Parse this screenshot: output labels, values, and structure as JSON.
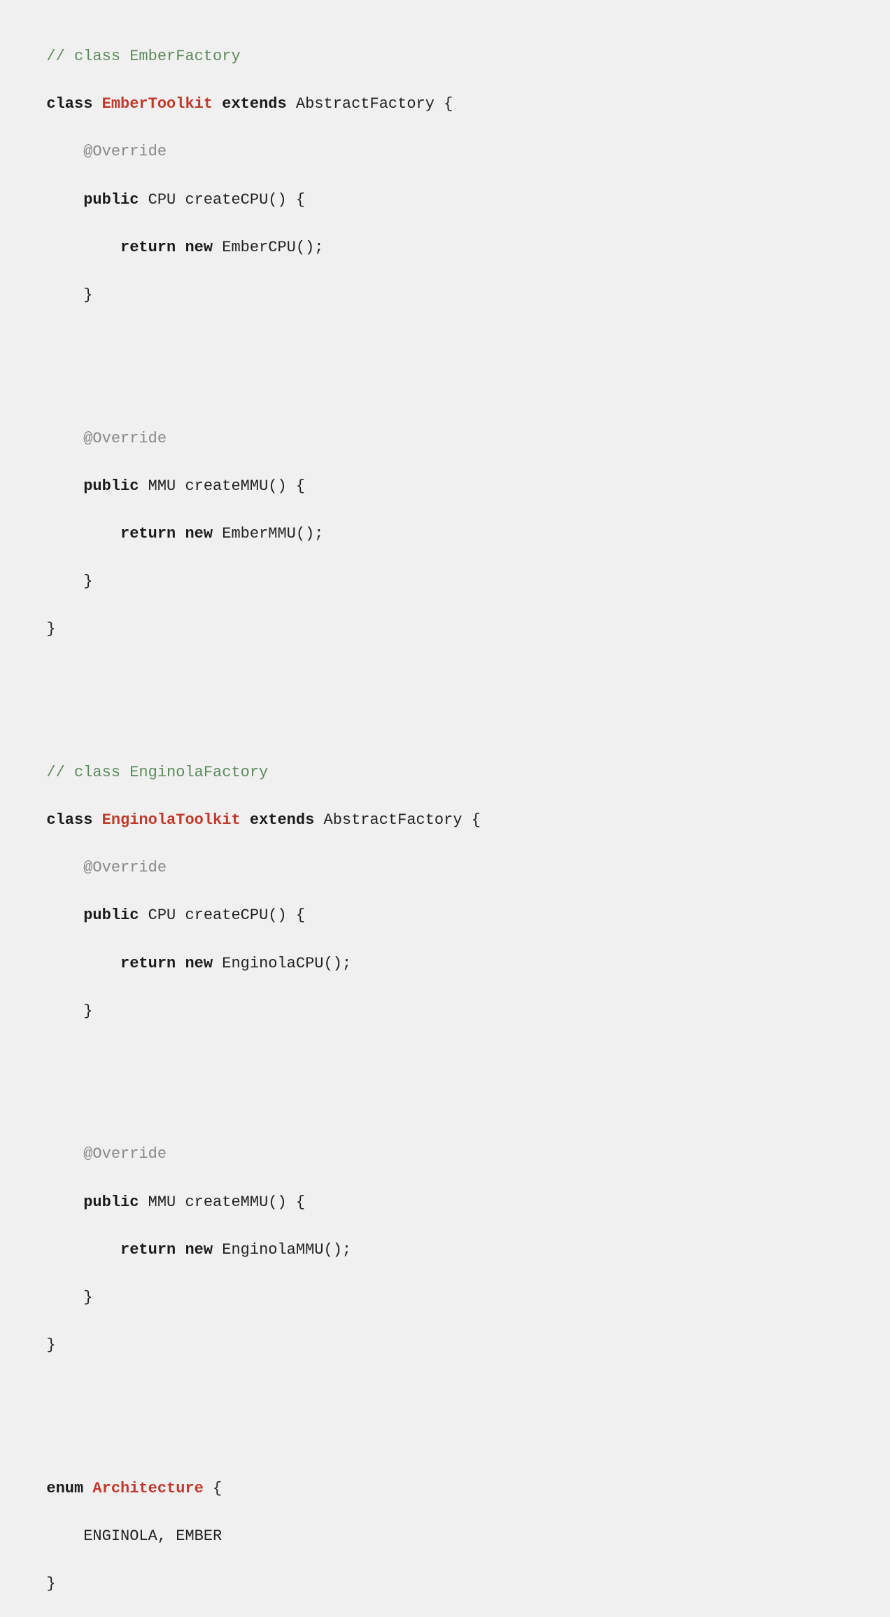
{
  "code": {
    "lines": [
      {
        "type": "comment",
        "text": "// class EmberFactory"
      },
      {
        "type": "mixed",
        "parts": [
          {
            "style": "keyword",
            "text": "class "
          },
          {
            "style": "class-name",
            "text": "EmberToolkit"
          },
          {
            "style": "keyword",
            "text": " extends"
          },
          {
            "style": "normal",
            "text": " AbstractFactory {"
          }
        ]
      },
      {
        "type": "mixed",
        "parts": [
          {
            "style": "annotation",
            "text": "    @Override"
          }
        ]
      },
      {
        "type": "mixed",
        "parts": [
          {
            "style": "keyword",
            "text": "    public"
          },
          {
            "style": "normal",
            "text": " CPU createCPU() {"
          }
        ]
      },
      {
        "type": "mixed",
        "parts": [
          {
            "style": "keyword",
            "text": "        return"
          },
          {
            "style": "keyword",
            "text": " new"
          },
          {
            "style": "normal",
            "text": " EmberCPU();"
          }
        ]
      },
      {
        "type": "normal",
        "text": "    }"
      },
      {
        "type": "blank"
      },
      {
        "type": "blank"
      },
      {
        "type": "mixed",
        "parts": [
          {
            "style": "annotation",
            "text": "    @Override"
          }
        ]
      },
      {
        "type": "mixed",
        "parts": [
          {
            "style": "keyword",
            "text": "    public"
          },
          {
            "style": "normal",
            "text": " MMU createMMU() {"
          }
        ]
      },
      {
        "type": "mixed",
        "parts": [
          {
            "style": "keyword",
            "text": "        return"
          },
          {
            "style": "keyword",
            "text": " new"
          },
          {
            "style": "normal",
            "text": " EmberMMU();"
          }
        ]
      },
      {
        "type": "normal",
        "text": "    }"
      },
      {
        "type": "normal",
        "text": "}"
      },
      {
        "type": "blank"
      },
      {
        "type": "blank"
      },
      {
        "type": "comment",
        "text": "// class EnginolaFactory"
      },
      {
        "type": "mixed",
        "parts": [
          {
            "style": "keyword",
            "text": "class "
          },
          {
            "style": "class-name",
            "text": "EnginolaToolkit"
          },
          {
            "style": "keyword",
            "text": " extends"
          },
          {
            "style": "normal",
            "text": " AbstractFactory {"
          }
        ]
      },
      {
        "type": "mixed",
        "parts": [
          {
            "style": "annotation",
            "text": "    @Override"
          }
        ]
      },
      {
        "type": "mixed",
        "parts": [
          {
            "style": "keyword",
            "text": "    public"
          },
          {
            "style": "normal",
            "text": " CPU createCPU() {"
          }
        ]
      },
      {
        "type": "mixed",
        "parts": [
          {
            "style": "keyword",
            "text": "        return"
          },
          {
            "style": "keyword",
            "text": " new"
          },
          {
            "style": "normal",
            "text": " EnginolaCPU();"
          }
        ]
      },
      {
        "type": "normal",
        "text": "    }"
      },
      {
        "type": "blank"
      },
      {
        "type": "blank"
      },
      {
        "type": "mixed",
        "parts": [
          {
            "style": "annotation",
            "text": "    @Override"
          }
        ]
      },
      {
        "type": "mixed",
        "parts": [
          {
            "style": "keyword",
            "text": "    public"
          },
          {
            "style": "normal",
            "text": " MMU createMMU() {"
          }
        ]
      },
      {
        "type": "mixed",
        "parts": [
          {
            "style": "keyword",
            "text": "        return"
          },
          {
            "style": "keyword",
            "text": " new"
          },
          {
            "style": "normal",
            "text": " EnginolaMMU();"
          }
        ]
      },
      {
        "type": "normal",
        "text": "    }"
      },
      {
        "type": "normal",
        "text": "}"
      },
      {
        "type": "blank"
      },
      {
        "type": "blank"
      },
      {
        "type": "mixed",
        "parts": [
          {
            "style": "keyword",
            "text": "enum "
          },
          {
            "style": "class-name",
            "text": "Architecture"
          },
          {
            "style": "normal",
            "text": " {"
          }
        ]
      },
      {
        "type": "normal",
        "text": "    ENGINOLA, EMBER"
      },
      {
        "type": "normal",
        "text": "}"
      }
    ]
  }
}
